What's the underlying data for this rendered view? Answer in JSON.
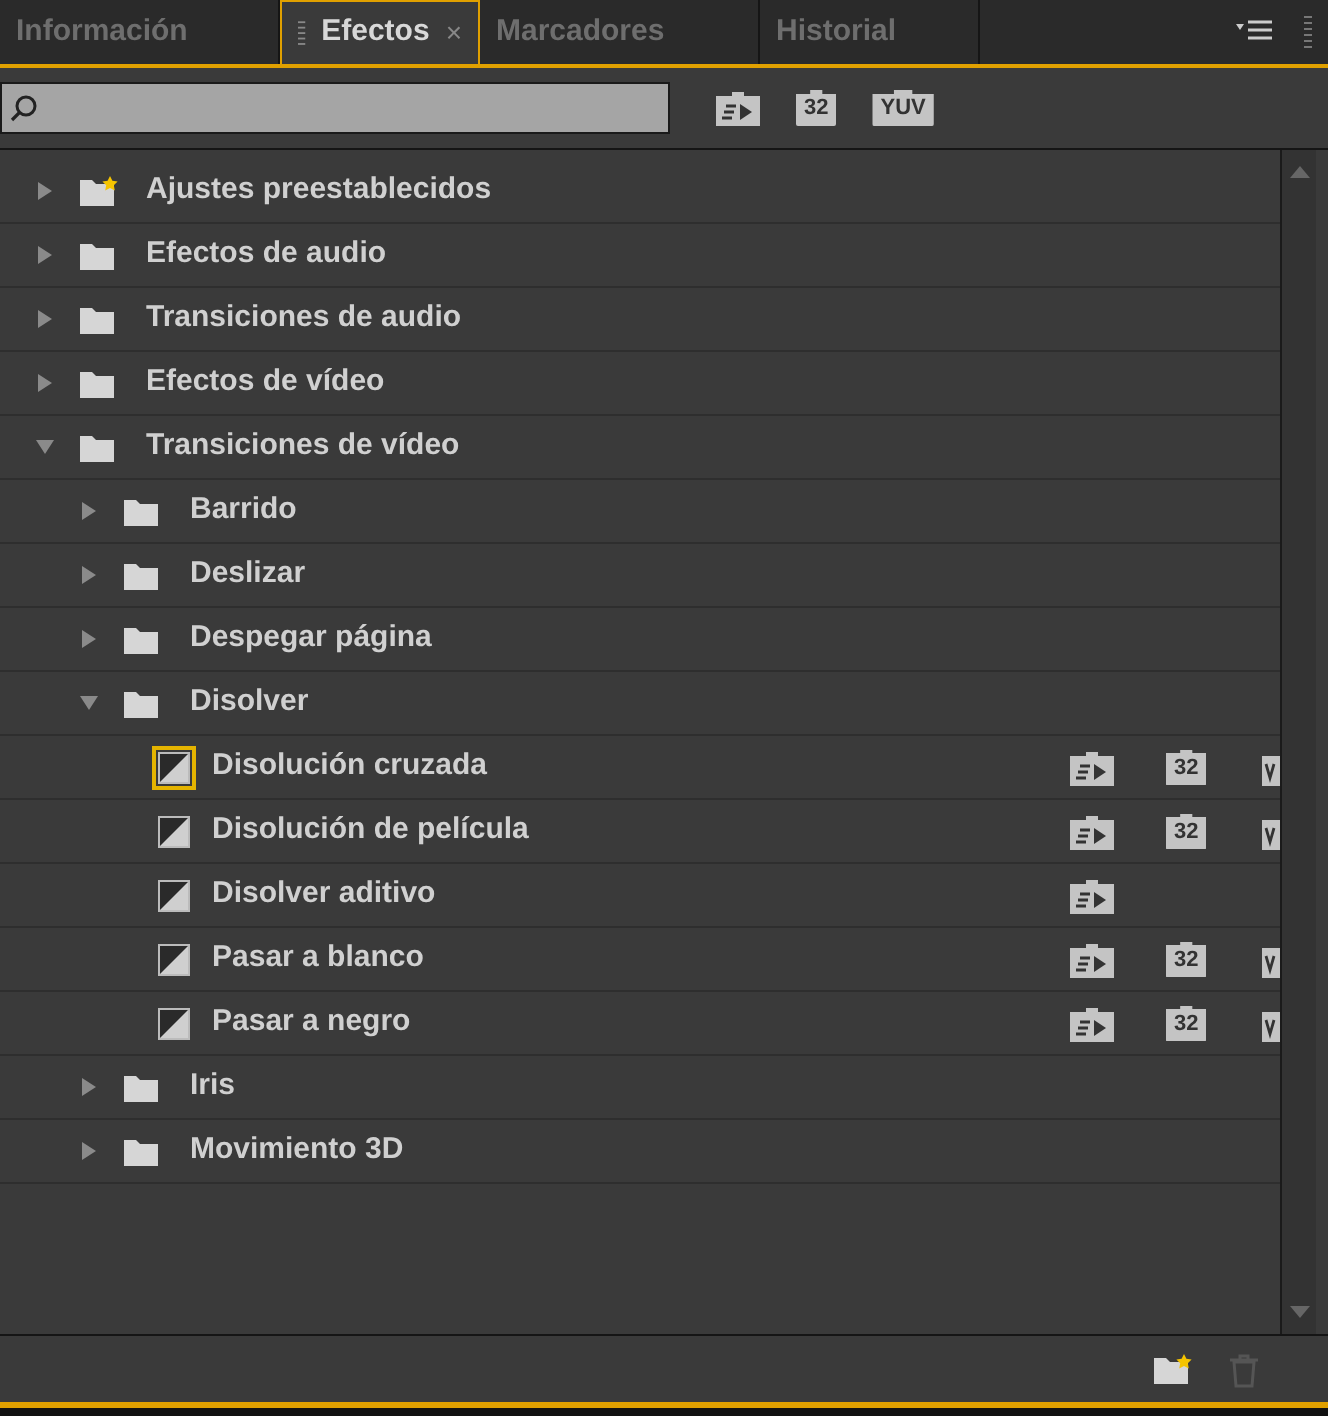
{
  "tabs": [
    {
      "label": "Información",
      "selected": false
    },
    {
      "label": "Efectos",
      "selected": true,
      "close": "×"
    },
    {
      "label": "Marcadores",
      "selected": false
    },
    {
      "label": "Historial",
      "selected": false
    }
  ],
  "toolbar": {
    "badges": [
      {
        "kind": "accel"
      },
      {
        "kind": "text",
        "text": "32"
      },
      {
        "kind": "text",
        "text": "YUV"
      }
    ]
  },
  "tree": [
    {
      "label": "Ajustes preestablecidos",
      "kind": "preset-folder",
      "expanded": false
    },
    {
      "label": "Efectos de audio",
      "kind": "folder",
      "expanded": false
    },
    {
      "label": "Transiciones de audio",
      "kind": "folder",
      "expanded": false
    },
    {
      "label": "Efectos de vídeo",
      "kind": "folder",
      "expanded": false
    },
    {
      "label": "Transiciones de vídeo",
      "kind": "folder",
      "expanded": true,
      "children": [
        {
          "label": "Barrido",
          "kind": "folder",
          "expanded": false
        },
        {
          "label": "Deslizar",
          "kind": "folder",
          "expanded": false
        },
        {
          "label": "Despegar página",
          "kind": "folder",
          "expanded": false
        },
        {
          "label": "Disolver",
          "kind": "folder",
          "expanded": true,
          "children": [
            {
              "label": "Disolución cruzada",
              "kind": "effect",
              "selected": true,
              "accel": true,
              "bits32": "32",
              "yuv": true
            },
            {
              "label": "Disolución de película",
              "kind": "effect",
              "selected": false,
              "accel": true,
              "bits32": "32",
              "yuv": true
            },
            {
              "label": "Disolver aditivo",
              "kind": "effect",
              "selected": false,
              "accel": true
            },
            {
              "label": "Pasar a blanco",
              "kind": "effect",
              "selected": false,
              "accel": true,
              "bits32": "32",
              "yuv": true
            },
            {
              "label": "Pasar a negro",
              "kind": "effect",
              "selected": false,
              "accel": true,
              "bits32": "32",
              "yuv": true
            }
          ]
        },
        {
          "label": "Iris",
          "kind": "folder",
          "expanded": false
        },
        {
          "label": "Movimiento 3D",
          "kind": "folder",
          "expanded": false
        }
      ]
    }
  ]
}
